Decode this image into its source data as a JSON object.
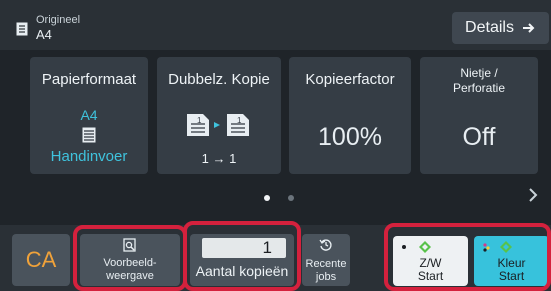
{
  "header": {
    "original_caption": "Origineel",
    "original_size": "A4",
    "details_label": "Details"
  },
  "tiles": {
    "paper": {
      "title": "Papierformaat",
      "size": "A4",
      "source": "Handinvoer"
    },
    "duplex": {
      "title": "Dubbelz. Kopie",
      "mode": "1 → 1"
    },
    "ratio": {
      "title": "Kopieerfactor",
      "value": "100%"
    },
    "staple": {
      "title_line1": "Nietje /",
      "title_line2": "Perforatie",
      "value": "Off"
    }
  },
  "pager": {
    "page": 1,
    "pages": 2
  },
  "bottom": {
    "ca_label": "CA",
    "preview_line1": "Voorbeeld-",
    "preview_line2": "weergave",
    "copies_value": "1",
    "copies_label": "Aantal kopieën",
    "recent_line1": "Recente",
    "recent_line2": "jobs",
    "bw_line1": "Z/W",
    "bw_line2": "Start",
    "color_line1": "Kleur",
    "color_line2": "Start"
  },
  "colors": {
    "accent": "#3fc3dd",
    "ca": "#f0a23a",
    "highlight": "#d4213d",
    "color_start": "#37c2dc"
  },
  "icons": {
    "original": "document-icon",
    "details": "arrow-right-icon",
    "paper": "paper-stack-icon",
    "duplex": "duplex-copy-icon",
    "preview": "preview-icon",
    "recent": "history-icon",
    "start": "diamond-start-icon",
    "next": "chevron-right-icon"
  }
}
